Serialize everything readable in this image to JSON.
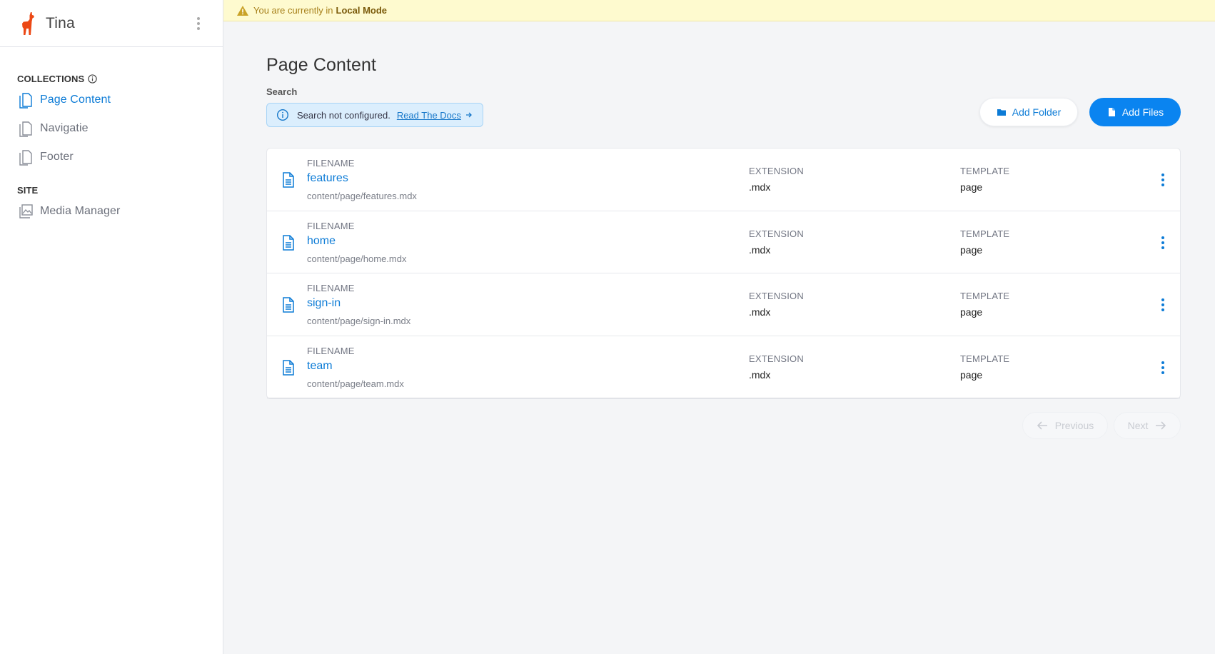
{
  "app": {
    "name": "Tina",
    "brand_color": "#ec4815",
    "accent_color": "#0c7bd6"
  },
  "banner": {
    "text": "You are currently in",
    "mode": "Local Mode",
    "icon": "warning-icon"
  },
  "sidebar": {
    "collections_heading": "COLLECTIONS",
    "collections": [
      {
        "label": "Page Content",
        "active": true,
        "icon": "document-icon"
      },
      {
        "label": "Navigatie",
        "active": false,
        "icon": "document-icon"
      },
      {
        "label": "Footer",
        "active": false,
        "icon": "document-icon"
      }
    ],
    "site_heading": "SITE",
    "site": [
      {
        "label": "Media Manager",
        "icon": "images-icon"
      }
    ]
  },
  "main": {
    "title": "Page Content",
    "search_label": "Search",
    "search_notice": "Search not configured.",
    "search_docs_link": "Read The Docs",
    "add_folder_label": "Add Folder",
    "add_files_label": "Add Files",
    "column_labels": {
      "filename": "FILENAME",
      "extension": "EXTENSION",
      "template": "TEMPLATE"
    },
    "rows": [
      {
        "name": "features",
        "path": "content/page/features.mdx",
        "extension": ".mdx",
        "template": "page"
      },
      {
        "name": "home",
        "path": "content/page/home.mdx",
        "extension": ".mdx",
        "template": "page"
      },
      {
        "name": "sign-in",
        "path": "content/page/sign-in.mdx",
        "extension": ".mdx",
        "template": "page"
      },
      {
        "name": "team",
        "path": "content/page/team.mdx",
        "extension": ".mdx",
        "template": "page"
      }
    ],
    "pagination": {
      "previous": "Previous",
      "next": "Next"
    }
  }
}
